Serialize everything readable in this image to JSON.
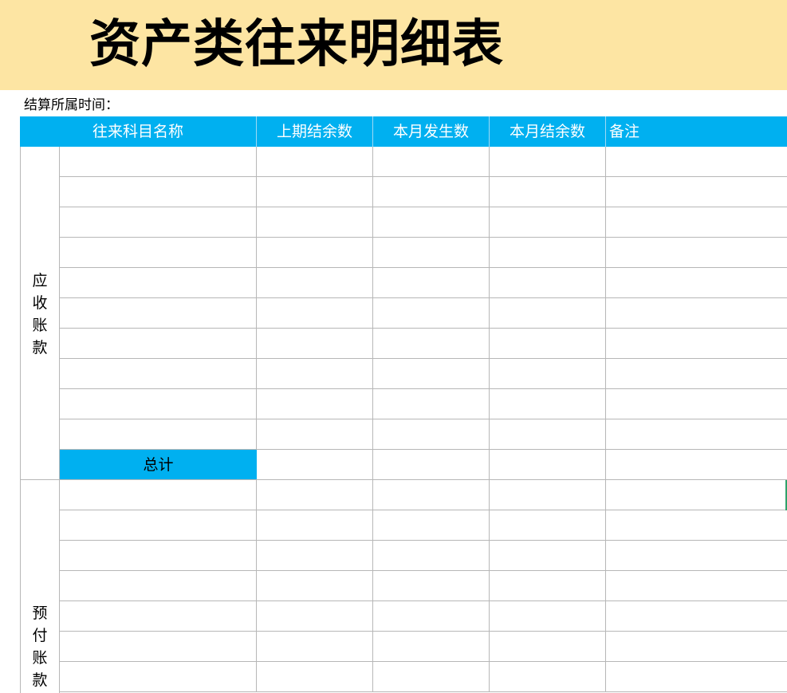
{
  "title": "资产类往来明细表",
  "period_label": "结算所属时间：",
  "columns": [
    "往来科目名称",
    "上期结余数",
    "本月发生数",
    "本月结余数",
    "备注"
  ],
  "sections": [
    {
      "label": "应\n收\n账\n款",
      "rows": 10,
      "total_label": "总计"
    },
    {
      "label": "预\n付\n账\n款",
      "rows": 7
    }
  ],
  "colors": {
    "title_background": "#fde5a3",
    "header_background": "#00b0f0",
    "header_text": "#ffffff",
    "grid_line": "#b7b7b7"
  }
}
